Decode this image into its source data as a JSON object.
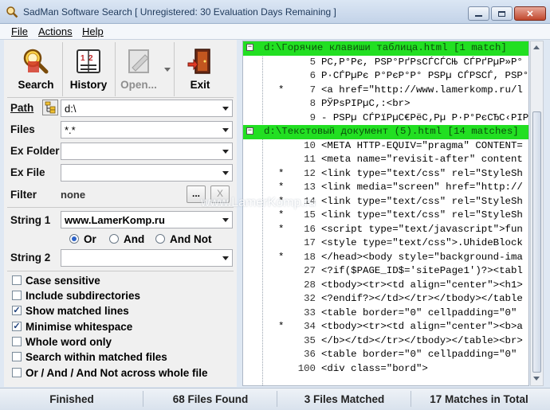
{
  "window": {
    "title": "SadMan Software Search [ Unregistered: 30 Evaluation Days Remaining ]"
  },
  "menu": [
    "File",
    "Actions",
    "Help"
  ],
  "toolbar": {
    "search": "Search",
    "history": "History",
    "open": "Open...",
    "exit": "Exit"
  },
  "form": {
    "path_label": "Path",
    "path_value": "d:\\",
    "files_label": "Files",
    "files_value": "*.*",
    "exfolder_label": "Ex Folder",
    "exfolder_value": "",
    "exfile_label": "Ex File",
    "exfile_value": "",
    "filter_label": "Filter",
    "filter_value": "none",
    "filter_more": "...",
    "filter_clear": "X",
    "string1_label": "String 1",
    "string1_value": "www.LamerKomp.ru",
    "radio": {
      "or": "Or",
      "and": "And",
      "andnot": "And Not",
      "selected": "Or"
    },
    "string2_label": "String 2",
    "string2_value": ""
  },
  "options": [
    {
      "label": "Case sensitive",
      "checked": false
    },
    {
      "label": "Include subdirectories",
      "checked": false
    },
    {
      "label": "Show matched lines",
      "checked": true
    },
    {
      "label": "Minimise whitespace",
      "checked": true
    },
    {
      "label": "Whole word only",
      "checked": false
    },
    {
      "label": "Search within matched files",
      "checked": false
    },
    {
      "label": "Or / And / And Not across whole file",
      "checked": false
    }
  ],
  "results": [
    {
      "type": "file",
      "text": "d:\\Горячие клавиши таблица.html [1 match]"
    },
    {
      "type": "line",
      "star": "",
      "num": "5",
      "text": "РС,Р°Рє, РЅР°РґРѕСЃСЃСЊ СЃРґРµР»Р°"
    },
    {
      "type": "line",
      "star": "",
      "num": "6",
      "text": "Р·СЃРµРє Р°РєР°Р° РЅРµ СЃРЅСЃ, РЅР°РґР"
    },
    {
      "type": "line",
      "star": "*",
      "num": "7",
      "text": "<a href=\"http://www.lamerkomp.ru/l"
    },
    {
      "type": "line",
      "star": "",
      "num": "8",
      "text": "РЎРѕРІРµС‚:<br>"
    },
    {
      "type": "line",
      "star": "",
      "num": "9",
      "text": "- РЅРµ СЃРїРµС€РёС‚Рµ Р·Р°РєСЂС‹РІР"
    },
    {
      "type": "file",
      "text": "d:\\Текстовый документ (5).html [14 matches]"
    },
    {
      "type": "line",
      "star": "",
      "num": "10",
      "text": "<META HTTP-EQUIV=\"pragma\" CONTENT="
    },
    {
      "type": "line",
      "star": "",
      "num": "11",
      "text": "<meta name=\"revisit-after\" content"
    },
    {
      "type": "line",
      "star": "*",
      "num": "12",
      "text": "<link type=\"text/css\" rel=\"StyleSh"
    },
    {
      "type": "line",
      "star": "*",
      "num": "13",
      "text": "<link media=\"screen\" href=\"http://"
    },
    {
      "type": "line",
      "star": "*",
      "num": "14",
      "text": "<link type=\"text/css\" rel=\"StyleSh"
    },
    {
      "type": "line",
      "star": "*",
      "num": "15",
      "text": "<link type=\"text/css\" rel=\"StyleSh"
    },
    {
      "type": "line",
      "star": "*",
      "num": "16",
      "text": "<script type=\"text/javascript\">fun"
    },
    {
      "type": "line",
      "star": "",
      "num": "17",
      "text": "<style type=\"text/css\">.UhideBlock"
    },
    {
      "type": "line",
      "star": "*",
      "num": "18",
      "text": "</head><body style=\"background-ima"
    },
    {
      "type": "line",
      "star": "",
      "num": "27",
      "text": "<?if($PAGE_ID$='sitePage1')?><tabl"
    },
    {
      "type": "line",
      "star": "",
      "num": "28",
      "text": "<tbody><tr><td align=\"center\"><h1>"
    },
    {
      "type": "line",
      "star": "",
      "num": "32",
      "text": "<?endif?></td></tr></tbody></table"
    },
    {
      "type": "line",
      "star": "",
      "num": "33",
      "text": "<table border=\"0\" cellpadding=\"0\" "
    },
    {
      "type": "line",
      "star": "*",
      "num": "34",
      "text": "<tbody><tr><td align=\"center\"><b>a"
    },
    {
      "type": "line",
      "star": "",
      "num": "35",
      "text": "</b></td></tr></tbody></table><br>"
    },
    {
      "type": "line",
      "star": "",
      "num": "36",
      "text": "<table border=\"0\" cellpadding=\"0\" "
    },
    {
      "type": "line",
      "star": "",
      "num": "100",
      "text": "<div class=\"bord\">"
    }
  ],
  "status": {
    "state": "Finished",
    "files_found": "68 Files Found",
    "files_matched": "3 Files Matched",
    "matches_total": "17 Matches in Total"
  },
  "watermark": "www.LamerKomp.ru"
}
